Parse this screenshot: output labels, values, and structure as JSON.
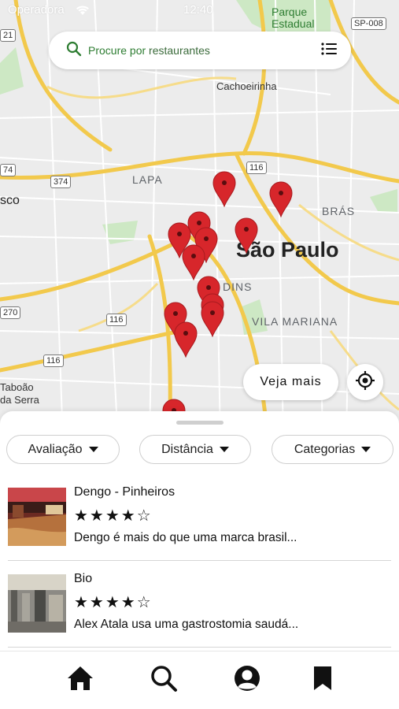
{
  "status_bar": {
    "carrier": "Operadora",
    "time": "12:40"
  },
  "search": {
    "placeholder_prefix": "Procure por",
    "placeholder_rest": " restaurantes",
    "icon": "search-icon",
    "list_icon": "list-icon"
  },
  "map": {
    "labels": {
      "parque": "Parque\nEstadual",
      "cachoeirinha": "Cachoeirinha",
      "lapa": "LAPA",
      "bras": "BRÁS",
      "sao_paulo": "São Paulo",
      "jardins": "DINS",
      "vila_mariana": "VILA MARIANA",
      "osasco": "sco",
      "taboao": "Taboão\nda Serra"
    },
    "shields": {
      "s21": "21",
      "sp008": "SP-008",
      "s74": "74",
      "s374": "374",
      "s116a": "116",
      "s116b": "116",
      "s116c": "116",
      "s270": "270"
    },
    "pin_color": "#d7262b",
    "veja_mais": "Veja mais"
  },
  "filters": [
    {
      "label": "Avaliação"
    },
    {
      "label": "Distância"
    },
    {
      "label": "Categorias"
    }
  ],
  "restaurants": [
    {
      "name": "Dengo - Pinheiros",
      "rating": "★★★★☆",
      "rating_value": 4,
      "description": "Dengo é mais do que uma marca brasil..."
    },
    {
      "name": "Bio",
      "rating": "★★★★☆",
      "rating_value": 4,
      "description": "Alex Atala usa uma gastrostomia saudá..."
    }
  ],
  "tabbar": {
    "items": [
      "home-icon",
      "search-icon",
      "profile-icon",
      "bookmark-icon"
    ]
  },
  "colors": {
    "accent": "#2e7d32",
    "pin": "#d7262b",
    "road_major": "#f6cf63",
    "map_bg": "#ececec"
  }
}
